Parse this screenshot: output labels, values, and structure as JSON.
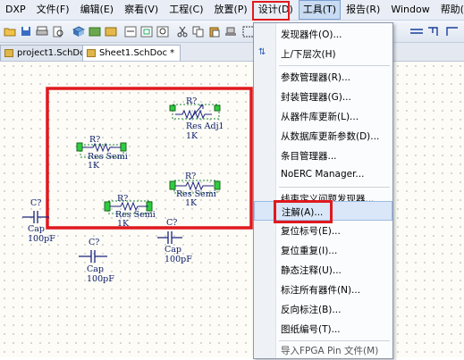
{
  "menubar": {
    "items": [
      "DXP",
      "文件(F)",
      "编辑(E)",
      "察看(V)",
      "工程(C)",
      "放置(P)",
      "设计(D)",
      "工具(T)",
      "报告(R)",
      "Window",
      "帮助(H)"
    ]
  },
  "tabs": [
    {
      "label": "project1.SchDoc"
    },
    {
      "label": "Sheet1.SchDoc *"
    }
  ],
  "components": {
    "r_top": {
      "designator": "R?",
      "comment": "Res Adj1",
      "value": "1K"
    },
    "r_left": {
      "designator": "R?",
      "comment": "Res Semi",
      "value": "1K"
    },
    "r_right": {
      "designator": "R?",
      "comment": "Res Semi",
      "value": "1K"
    },
    "r_bottom": {
      "designator": "R?",
      "comment": "Res Semi",
      "value": "1K"
    },
    "c_left": {
      "designator": "C?",
      "comment": "Cap",
      "value": "100pF"
    },
    "c_mid": {
      "designator": "C?",
      "comment": "Cap",
      "value": "100pF"
    },
    "c_right": {
      "designator": "C?",
      "comment": "Cap",
      "value": "100pF"
    }
  },
  "tools_menu": {
    "items": [
      "发现器件(O)...",
      "上/下层次(H)",
      "参数管理器(R)...",
      "封装管理器(G)...",
      "从器件库更新(L)...",
      "从数据库更新参数(D)...",
      "条目管理器...",
      "NoERC Manager...",
      "线束定义问题发现器...",
      "注解(A)...",
      "复位标号(E)...",
      "复位重复(I)...",
      "静态注释(U)...",
      "标注所有器件(N)...",
      "反向标注(B)...",
      "图纸编号(T)...",
      "导入FPGA Pin 文件(M)"
    ]
  },
  "colors": {
    "highlight_box": "#e0191e",
    "wire": "#1a237e",
    "pin_green": "#2ecc40",
    "selection": "#1f8a3a"
  }
}
